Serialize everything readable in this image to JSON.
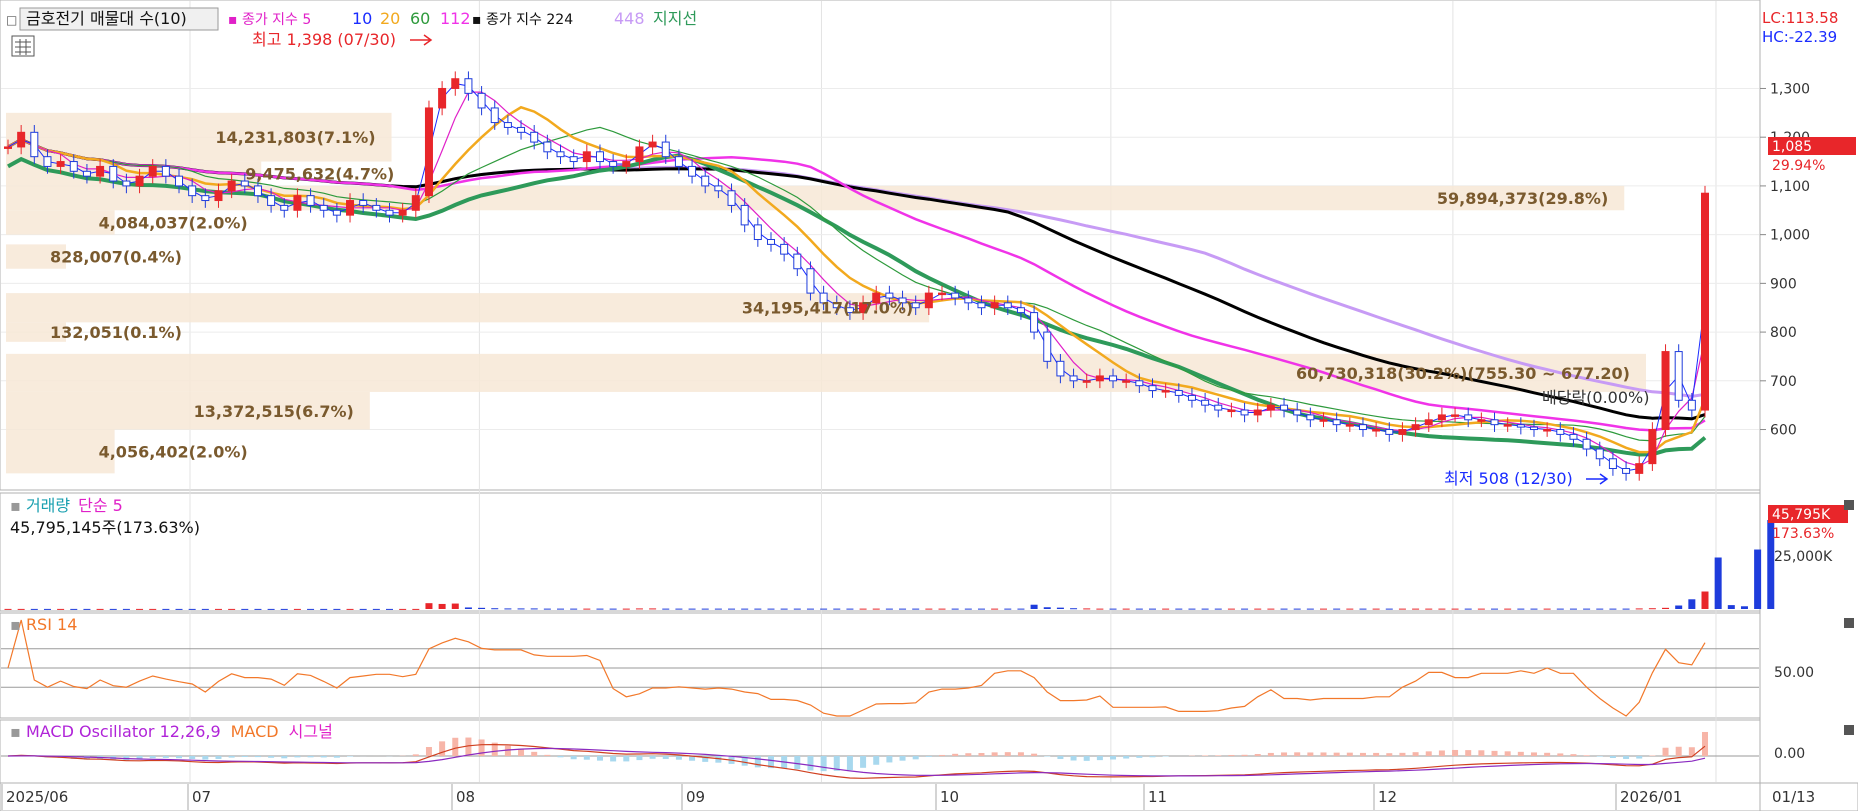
{
  "header": {
    "title": "금호전기 매물대 수(10)",
    "ma_label": "종가 지수 5",
    "ma_periods": [
      "10",
      "20",
      "60",
      "112"
    ],
    "ma_long_label": "종가 지수 224",
    "ma_long_period2": "448",
    "support_label": "지지선"
  },
  "colors": {
    "up": "#e8262a",
    "down": "#1e3cdc",
    "ma5": "#1a2cff",
    "ma10": "#e020c8",
    "ma20": "#f2a91e",
    "ma60": "#2e9a3c",
    "ma112": "#f033e8",
    "ma224": "#000000",
    "ma448": "#c79bf5",
    "support": "#2e9a5a",
    "volume_profile": "#f7e7d6"
  },
  "annotations": {
    "high": "최고 1,398 (07/30)",
    "low": "최저 508 (12/30)",
    "dividend": "배당락(0.00%)"
  },
  "price_axis": {
    "lc": "LC:113.58",
    "hc": "HC:-22.39",
    "ticks": [
      "1,300",
      "1,200",
      "1,100",
      "1,000",
      "900",
      "800",
      "700",
      "600"
    ],
    "current": "1,085",
    "current_pct": "29.94%"
  },
  "volume_panel": {
    "title": "거래량",
    "ma_label": "단순 5",
    "value_text": "45,795,145주(173.63%)",
    "tick": "25,000K",
    "current": "45,795K",
    "current_pct": "173.63%"
  },
  "rsi_panel": {
    "title": "RSI 14",
    "tick": "50.00"
  },
  "macd_panel": {
    "title": "MACD Oscillator 12,26,9",
    "macd_label": "MACD",
    "signal_label": "시그널",
    "tick": "0.00"
  },
  "x_axis": {
    "labels": [
      "2025/06",
      "07",
      "08",
      "09",
      "10",
      "11",
      "12",
      "2026/01"
    ],
    "right_label": "01/13"
  },
  "chart_data": {
    "type": "candlestick",
    "volume_profile": [
      {
        "label": "14,231,803(7.1%)",
        "price_range": [
          1150,
          1250
        ],
        "share": 7.1
      },
      {
        "label": "9,475,632(4.7%)",
        "price_range": [
          1100,
          1150
        ],
        "share": 4.7
      },
      {
        "label": "59,894,373(29.8%)",
        "price_range": [
          1050,
          1100
        ],
        "share": 29.8
      },
      {
        "label": "4,084,037(2.0%)",
        "price_range": [
          1000,
          1050
        ],
        "share": 2.0
      },
      {
        "label": "828,007(0.4%)",
        "price_range": [
          930,
          980
        ],
        "share": 0.4
      },
      {
        "label": "34,195,417(17.0%)",
        "price_range": [
          820,
          880
        ],
        "share": 17.0
      },
      {
        "label": "132,051(0.1%)",
        "price_range": [
          780,
          820
        ],
        "share": 0.1
      },
      {
        "label": "60,730,318(30.2%)(755.30 ~ 677.20)",
        "price_range": [
          677.2,
          755.3
        ],
        "share": 30.2
      },
      {
        "label": "13,372,515(6.7%)",
        "price_range": [
          600,
          677
        ],
        "share": 6.7
      },
      {
        "label": "4,056,402(2.0%)",
        "price_range": [
          510,
          600
        ],
        "share": 2.0
      }
    ],
    "price_close": [
      1180,
      1210,
      1160,
      1140,
      1150,
      1130,
      1120,
      1140,
      1110,
      1100,
      1120,
      1140,
      1120,
      1100,
      1080,
      1070,
      1090,
      1110,
      1100,
      1080,
      1060,
      1050,
      1080,
      1060,
      1050,
      1040,
      1070,
      1060,
      1050,
      1040,
      1050,
      1080,
      1260,
      1300,
      1320,
      1290,
      1260,
      1230,
      1220,
      1210,
      1190,
      1170,
      1160,
      1150,
      1170,
      1150,
      1140,
      1150,
      1180,
      1190,
      1160,
      1140,
      1120,
      1100,
      1090,
      1060,
      1020,
      990,
      980,
      960,
      930,
      880,
      860,
      850,
      840,
      860,
      880,
      870,
      860,
      850,
      880,
      880,
      870,
      860,
      850,
      860,
      850,
      840,
      800,
      740,
      710,
      700,
      700,
      710,
      700,
      700,
      690,
      680,
      680,
      670,
      660,
      650,
      640,
      640,
      630,
      640,
      650,
      640,
      630,
      620,
      620,
      610,
      610,
      600,
      600,
      590,
      600,
      610,
      620,
      630,
      630,
      620,
      620,
      610,
      610,
      605,
      600,
      600,
      590,
      580,
      560,
      540,
      520,
      510,
      530,
      600,
      760,
      660,
      640,
      1085
    ],
    "volume_k": [
      50,
      50,
      50,
      50,
      50,
      50,
      50,
      50,
      50,
      50,
      50,
      50,
      50,
      50,
      50,
      50,
      50,
      50,
      50,
      50,
      50,
      50,
      50,
      50,
      50,
      50,
      50,
      50,
      50,
      50,
      50,
      50,
      3000,
      2600,
      2800,
      800,
      600,
      400,
      300,
      300,
      300,
      200,
      200,
      200,
      200,
      200,
      200,
      200,
      300,
      300,
      200,
      200,
      200,
      200,
      200,
      200,
      200,
      200,
      200,
      200,
      200,
      200,
      200,
      200,
      200,
      200,
      200,
      200,
      200,
      200,
      200,
      200,
      200,
      200,
      200,
      200,
      200,
      200,
      2200,
      900,
      700,
      400,
      300,
      200,
      200,
      200,
      200,
      200,
      200,
      200,
      200,
      200,
      200,
      200,
      200,
      200,
      200,
      200,
      200,
      200,
      200,
      200,
      200,
      200,
      200,
      200,
      200,
      200,
      200,
      200,
      200,
      200,
      200,
      200,
      200,
      200,
      200,
      200,
      200,
      200,
      200,
      200,
      200,
      200,
      300,
      400,
      600,
      1800,
      5000,
      9000,
      26500,
      2000,
      1400,
      30600,
      45795
    ],
    "ylim": [
      480,
      1420
    ],
    "dates": [
      "2025/06",
      "07",
      "08",
      "09",
      "10",
      "11",
      "12",
      "2026/01"
    ]
  }
}
